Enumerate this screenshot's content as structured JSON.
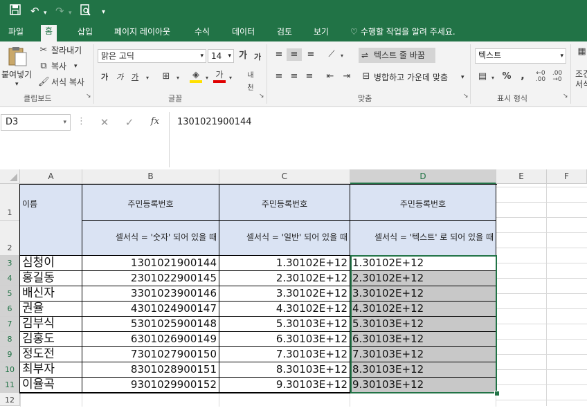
{
  "ribbon": {
    "paste_label": "붙여넣기",
    "cut_label": "잘라내기",
    "copy_label": "복사",
    "format_painter_label": "서식 복사",
    "clipboard_group": "클립보드",
    "font_name": "맑은 고딕",
    "font_size": "14",
    "font_group": "글꼴",
    "wrap_text_label": "텍스트 줄 바꿈",
    "merge_center_label": "병합하고 가운데 맞춤",
    "alignment_group": "맞춤",
    "number_format": "텍스트",
    "number_group": "표시 형식",
    "percent_symbol": "%",
    "comma_symbol": ",",
    "conditional_label_1": "조건",
    "conditional_label_2": "서식"
  },
  "menu": {
    "tabs": [
      "파일",
      "홈",
      "삽입",
      "페이지 레이아웃",
      "수식",
      "데이터",
      "검토",
      "보기"
    ],
    "active_tab": "홈",
    "tell_me": "수행할 작업을 알려 주세요."
  },
  "formula_bar": {
    "name_box": "D3",
    "fx_label": "fx",
    "content": "1301021900144"
  },
  "sheet": {
    "columns": [
      "A",
      "B",
      "C",
      "D",
      "E",
      "F"
    ],
    "rows": [
      "1",
      "2",
      "3",
      "4",
      "5",
      "6",
      "7",
      "8",
      "9",
      "10",
      "11",
      "12"
    ],
    "header_row1": {
      "a": "이름",
      "b": "주민등록번호",
      "c": "주민등록번호",
      "d": "주민등록번호"
    },
    "header_row2": {
      "b": "셀서식 = '숫자' 되어 있을 때",
      "c": "셀서식 = '일반' 되어 있을 때",
      "d": "셀서식 = '텍스트' 로 되어 있을 때"
    },
    "data": [
      {
        "name": "심청이",
        "number": "1301021900144",
        "general": "1.30102E+12",
        "text": "1.30102E+12"
      },
      {
        "name": "홍길동",
        "number": "2301022900145",
        "general": "2.30102E+12",
        "text": "2.30102E+12"
      },
      {
        "name": "배신자",
        "number": "3301023900146",
        "general": "3.30102E+12",
        "text": "3.30102E+12"
      },
      {
        "name": "권율",
        "number": "4301024900147",
        "general": "4.30102E+12",
        "text": "4.30102E+12"
      },
      {
        "name": "김부식",
        "number": "5301025900148",
        "general": "5.30103E+12",
        "text": "5.30103E+12"
      },
      {
        "name": "김홍도",
        "number": "6301026900149",
        "general": "6.30103E+12",
        "text": "6.30103E+12"
      },
      {
        "name": "정도전",
        "number": "7301027900150",
        "general": "7.30103E+12",
        "text": "7.30103E+12"
      },
      {
        "name": "최부자",
        "number": "8301028900151",
        "general": "8.30103E+12",
        "text": "8.30103E+12"
      },
      {
        "name": "이율곡",
        "number": "9301029900152",
        "general": "9.30103E+12",
        "text": "9.30103E+12"
      }
    ]
  },
  "colors": {
    "excel_green": "#217346",
    "header_fill": "#dae3f3",
    "selection_fill": "#c8c8c8"
  }
}
